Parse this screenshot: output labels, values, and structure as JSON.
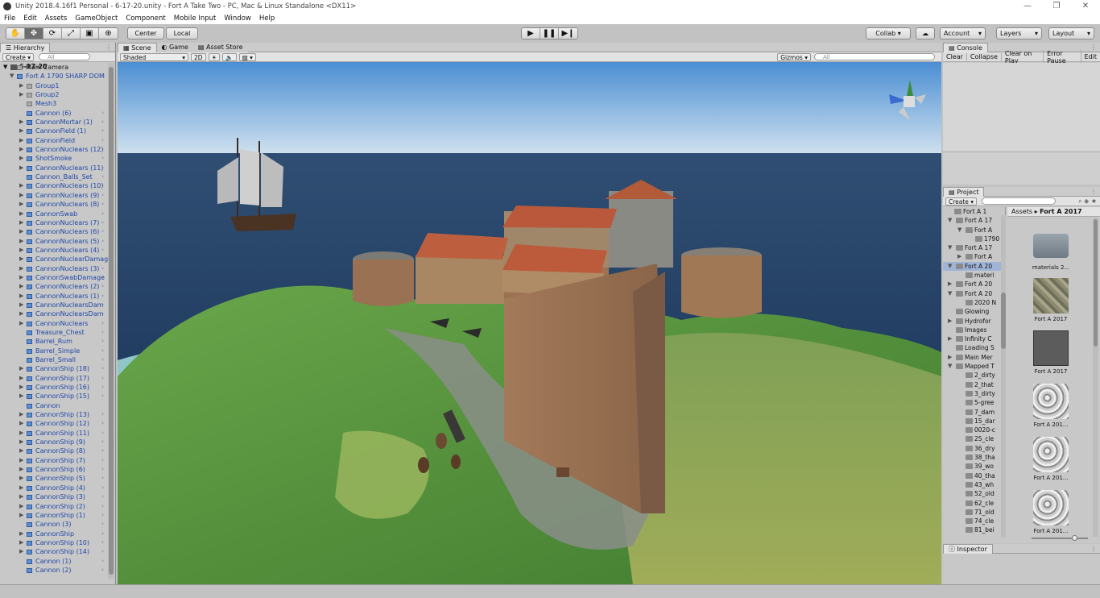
{
  "window": {
    "title": "Unity 2018.4.16f1 Personal - 6-17-20.unity - Fort A Take Two - PC, Mac & Linux Standalone <DX11>",
    "controls": [
      "—",
      "❐",
      "✕"
    ]
  },
  "menu": [
    "File",
    "Edit",
    "Assets",
    "GameObject",
    "Component",
    "Mobile Input",
    "Window",
    "Help"
  ],
  "toolbar": {
    "pivot": "Center",
    "space": "Local",
    "collab": "Collab ▾",
    "account": "Account",
    "layers": "Layers",
    "layout": "Layout"
  },
  "hierarchy": {
    "tab": "Hierarchy",
    "create": "Create",
    "search_placeholder": "All",
    "scene": "6-17-20",
    "items": [
      {
        "label": "Main Camera",
        "indent": 1,
        "black": true,
        "arrow": false,
        "chev": false
      },
      {
        "label": "Fort A 1790 SHARP DOM",
        "indent": 1,
        "black": false,
        "arrow": true,
        "open": true,
        "chev": false
      },
      {
        "label": "Group1",
        "indent": 2,
        "black": false,
        "arrow": true,
        "chev": false,
        "gray": true
      },
      {
        "label": "Group2",
        "indent": 2,
        "black": false,
        "arrow": true,
        "chev": false,
        "gray": true
      },
      {
        "label": "Mesh3",
        "indent": 2,
        "black": false,
        "arrow": false,
        "chev": false,
        "gray": true
      },
      {
        "label": "Cannon (6)",
        "indent": 2,
        "arrow": false,
        "chev": true
      },
      {
        "label": "CannonMortar (1)",
        "indent": 2,
        "arrow": true,
        "chev": true
      },
      {
        "label": "CannonField (1)",
        "indent": 2,
        "arrow": true,
        "chev": true
      },
      {
        "label": "CannonField",
        "indent": 2,
        "arrow": true,
        "chev": true
      },
      {
        "label": "CannonNuclears (12)",
        "indent": 2,
        "arrow": true,
        "chev": true
      },
      {
        "label": "ShotSmoke",
        "indent": 2,
        "arrow": true,
        "chev": true
      },
      {
        "label": "CannonNuclears (11)",
        "indent": 2,
        "arrow": true,
        "chev": true
      },
      {
        "label": "Cannon_Balls_Set",
        "indent": 2,
        "arrow": false,
        "chev": true
      },
      {
        "label": "CannonNuclears (10)",
        "indent": 2,
        "arrow": true,
        "chev": true
      },
      {
        "label": "CannonNuclears (9)",
        "indent": 2,
        "arrow": true,
        "chev": true
      },
      {
        "label": "CannonNuclears (8)",
        "indent": 2,
        "arrow": true,
        "chev": true
      },
      {
        "label": "CannonSwab",
        "indent": 2,
        "arrow": true,
        "chev": true
      },
      {
        "label": "CannonNuclears (7)",
        "indent": 2,
        "arrow": true,
        "chev": true
      },
      {
        "label": "CannonNuclears (6)",
        "indent": 2,
        "arrow": true,
        "chev": true
      },
      {
        "label": "CannonNuclears (5)",
        "indent": 2,
        "arrow": true,
        "chev": true
      },
      {
        "label": "CannonNuclears (4)",
        "indent": 2,
        "arrow": true,
        "chev": true
      },
      {
        "label": "CannonNuclearDamag",
        "indent": 2,
        "arrow": true,
        "chev": true
      },
      {
        "label": "CannonNuclears (3)",
        "indent": 2,
        "arrow": true,
        "chev": true
      },
      {
        "label": "CannonSwabDamage",
        "indent": 2,
        "arrow": true,
        "chev": true
      },
      {
        "label": "CannonNuclears (2)",
        "indent": 2,
        "arrow": true,
        "chev": true
      },
      {
        "label": "CannonNuclears (1)",
        "indent": 2,
        "arrow": true,
        "chev": true
      },
      {
        "label": "CannonNuclearsDam",
        "indent": 2,
        "arrow": true,
        "chev": true
      },
      {
        "label": "CannonNuclearsDam",
        "indent": 2,
        "arrow": true,
        "chev": true
      },
      {
        "label": "CannonNuclears",
        "indent": 2,
        "arrow": true,
        "chev": true
      },
      {
        "label": "Treasure_Chest",
        "indent": 2,
        "arrow": false,
        "chev": true
      },
      {
        "label": "Barrel_Rum",
        "indent": 2,
        "arrow": false,
        "chev": true
      },
      {
        "label": "Barrel_Simple",
        "indent": 2,
        "arrow": false,
        "chev": true
      },
      {
        "label": "Barrel_Small",
        "indent": 2,
        "arrow": false,
        "chev": true
      },
      {
        "label": "CannonShip (18)",
        "indent": 2,
        "arrow": true,
        "chev": true
      },
      {
        "label": "CannonShip (17)",
        "indent": 2,
        "arrow": true,
        "chev": true
      },
      {
        "label": "CannonShip (16)",
        "indent": 2,
        "arrow": true,
        "chev": true
      },
      {
        "label": "CannonShip (15)",
        "indent": 2,
        "arrow": true,
        "chev": true
      },
      {
        "label": "Cannon",
        "indent": 2,
        "arrow": false,
        "chev": false
      },
      {
        "label": "CannonShip (13)",
        "indent": 2,
        "arrow": true,
        "chev": true
      },
      {
        "label": "CannonShip (12)",
        "indent": 2,
        "arrow": true,
        "chev": true
      },
      {
        "label": "CannonShip (11)",
        "indent": 2,
        "arrow": true,
        "chev": true
      },
      {
        "label": "CannonShip (9)",
        "indent": 2,
        "arrow": true,
        "chev": true
      },
      {
        "label": "CannonShip (8)",
        "indent": 2,
        "arrow": true,
        "chev": true
      },
      {
        "label": "CannonShip (7)",
        "indent": 2,
        "arrow": true,
        "chev": true
      },
      {
        "label": "CannonShip (6)",
        "indent": 2,
        "arrow": true,
        "chev": true
      },
      {
        "label": "CannonShip (5)",
        "indent": 2,
        "arrow": true,
        "chev": true
      },
      {
        "label": "CannonShip (4)",
        "indent": 2,
        "arrow": true,
        "chev": true
      },
      {
        "label": "CannonShip (3)",
        "indent": 2,
        "arrow": true,
        "chev": true
      },
      {
        "label": "CannonShip (2)",
        "indent": 2,
        "arrow": true,
        "chev": true
      },
      {
        "label": "CannonShip (1)",
        "indent": 2,
        "arrow": true,
        "chev": true
      },
      {
        "label": "Cannon (3)",
        "indent": 2,
        "arrow": false,
        "chev": true
      },
      {
        "label": "CannonShip",
        "indent": 2,
        "arrow": true,
        "chev": true
      },
      {
        "label": "CannonShip (10)",
        "indent": 2,
        "arrow": true,
        "chev": true
      },
      {
        "label": "CannonShip (14)",
        "indent": 2,
        "arrow": true,
        "chev": true
      },
      {
        "label": "Cannon (1)",
        "indent": 2,
        "arrow": false,
        "chev": true
      },
      {
        "label": "Cannon (2)",
        "indent": 2,
        "arrow": false,
        "chev": true
      }
    ]
  },
  "scene": {
    "tabs": [
      "Scene",
      "Game",
      "Asset Store"
    ],
    "shading": "Shaded",
    "mode_2d": "2D",
    "gizmos": "Gizmos ▾",
    "search_placeholder": "All"
  },
  "console": {
    "tab": "Console",
    "buttons": [
      "Clear",
      "Collapse",
      "Clear on Play",
      "Error Pause",
      "Edit"
    ]
  },
  "project": {
    "tab": "Project",
    "create": "Create",
    "breadcrumb_root": "Assets",
    "breadcrumb_sep": "▸",
    "breadcrumb_current": "Fort A 2017",
    "tree": [
      {
        "label": "Fort A 1",
        "x": 14,
        "arrow": "",
        "sel": false
      },
      {
        "label": "Fort A 17",
        "x": 16,
        "arrow": "▼",
        "sel": false
      },
      {
        "label": "Fort A",
        "x": 28,
        "arrow": "▼",
        "sel": false
      },
      {
        "label": "1790",
        "x": 40,
        "arrow": "",
        "sel": false
      },
      {
        "label": "Fort A 17",
        "x": 16,
        "arrow": "▼",
        "sel": false
      },
      {
        "label": "Fort A",
        "x": 28,
        "arrow": "▶",
        "sel": false
      },
      {
        "label": "Fort A 20",
        "x": 16,
        "arrow": "▼",
        "sel": true
      },
      {
        "label": "materi",
        "x": 28,
        "arrow": "",
        "sel": false
      },
      {
        "label": "Fort A 20",
        "x": 16,
        "arrow": "▶",
        "sel": false
      },
      {
        "label": "Fort A 20",
        "x": 16,
        "arrow": "▼",
        "sel": false
      },
      {
        "label": "2020 N",
        "x": 28,
        "arrow": "",
        "sel": false
      },
      {
        "label": "Glowing",
        "x": 16,
        "arrow": "",
        "sel": false
      },
      {
        "label": "Hydrofor",
        "x": 16,
        "arrow": "▶",
        "sel": false
      },
      {
        "label": "Images",
        "x": 16,
        "arrow": "",
        "sel": false
      },
      {
        "label": "Infinity C",
        "x": 16,
        "arrow": "▶",
        "sel": false
      },
      {
        "label": "Loading S",
        "x": 16,
        "arrow": "",
        "sel": false
      },
      {
        "label": "Main Mer",
        "x": 16,
        "arrow": "▶",
        "sel": false
      },
      {
        "label": "Mapped T",
        "x": 16,
        "arrow": "▼",
        "sel": false
      },
      {
        "label": "2_dirty",
        "x": 28,
        "arrow": "",
        "sel": false
      },
      {
        "label": "2_that",
        "x": 28,
        "arrow": "",
        "sel": false
      },
      {
        "label": "3_dirty",
        "x": 28,
        "arrow": "",
        "sel": false
      },
      {
        "label": "5-gree",
        "x": 28,
        "arrow": "",
        "sel": false
      },
      {
        "label": "7_dam",
        "x": 28,
        "arrow": "",
        "sel": false
      },
      {
        "label": "15_dar",
        "x": 28,
        "arrow": "",
        "sel": false
      },
      {
        "label": "0020-c",
        "x": 28,
        "arrow": "",
        "sel": false
      },
      {
        "label": "25_cle",
        "x": 28,
        "arrow": "",
        "sel": false
      },
      {
        "label": "36_dry",
        "x": 28,
        "arrow": "",
        "sel": false
      },
      {
        "label": "38_tha",
        "x": 28,
        "arrow": "",
        "sel": false
      },
      {
        "label": "39_wo",
        "x": 28,
        "arrow": "",
        "sel": false
      },
      {
        "label": "40_tha",
        "x": 28,
        "arrow": "",
        "sel": false
      },
      {
        "label": "43_wh",
        "x": 28,
        "arrow": "",
        "sel": false
      },
      {
        "label": "52_old",
        "x": 28,
        "arrow": "",
        "sel": false
      },
      {
        "label": "62_cle",
        "x": 28,
        "arrow": "",
        "sel": false
      },
      {
        "label": "71_old",
        "x": 28,
        "arrow": "",
        "sel": false
      },
      {
        "label": "74_cle",
        "x": 28,
        "arrow": "",
        "sel": false
      },
      {
        "label": "81_bei",
        "x": 28,
        "arrow": "",
        "sel": false
      }
    ],
    "assets": [
      {
        "label": "materials 2...",
        "kind": "folder"
      },
      {
        "label": "Fort A 2017",
        "kind": "texture"
      },
      {
        "label": "Fort A 2017",
        "kind": "model"
      },
      {
        "label": "Fort A 201...",
        "kind": "texture2"
      },
      {
        "label": "Fort A 201...",
        "kind": "texture2"
      },
      {
        "label": "Fort A 201...",
        "kind": "texture2"
      }
    ]
  },
  "inspector": {
    "tab": "Inspector"
  },
  "colors": {
    "link_blue": "#1f47a6",
    "panel": "#c8c8c8",
    "sky_top": "#4a8ed3",
    "sea": "#27466e",
    "grass": "#5e9c3f"
  }
}
